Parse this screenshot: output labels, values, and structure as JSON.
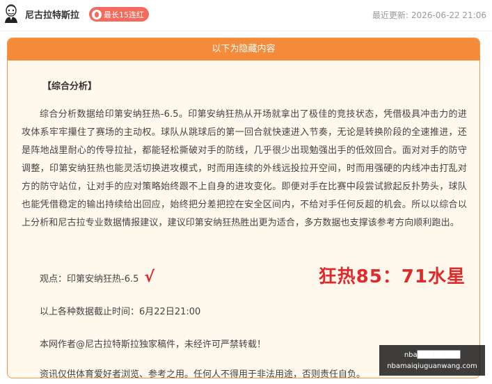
{
  "header": {
    "author": "尼古拉特斯拉",
    "badge": "最长15连红",
    "updated_label": "最近更新:",
    "updated_time": "2026-06-22 21:06"
  },
  "panel": {
    "title": "以下为隐藏内容",
    "section_title": "【综合分析】",
    "analysis": "综合分析数据给印第安纳狂热-6.5。印第安纳狂热从开场就拿出了极佳的竞技状态，凭借极具冲击力的进攻体系牢牢攥住了赛场的主动权。球队从跳球后的第一回合就快速进入节奏，无论是转换阶段的全速推进，还是阵地战里耐心的传导拉扯，都能轻松撕破对手的防线，几乎很少出现勉强出手的低效回合。面对对手的防守调整，印第安纳狂热也能灵活切换进攻模式，时而用连续的外线远投拉开空间，时而用强硬的内线冲击打乱对方的防守站位，让对手的应对策略始终跟不上自身的进攻变化。即便对手在比赛中段尝试掀起反扑势头，球队也能凭借稳定的输出持续给出回应，始终把分差把控在安全区间内，不给对手任何反超的机会。所以以综合以上分析和尼古拉专业数据情报建议，建议印第安纳狂热胜出更为适合，多方数据也支撑该参考方向顺利跑出。",
    "view_label": "观点：印第安纳狂热-6.5",
    "check": "√",
    "score": "狂热85：71水星",
    "cutoff": "以上各种数据截止时间：6月22日21:00",
    "copyright": "本网作者@尼古拉特斯拉独家稿件，未经许可严禁转载！",
    "disclaimer": "资讯仅供体育爱好者浏览、参考之用。任何人不得用于非法用途，否则责任自负。"
  },
  "watermark": {
    "line1": "nba████████",
    "line2": "nbamaiqiuguanwang.com"
  }
}
